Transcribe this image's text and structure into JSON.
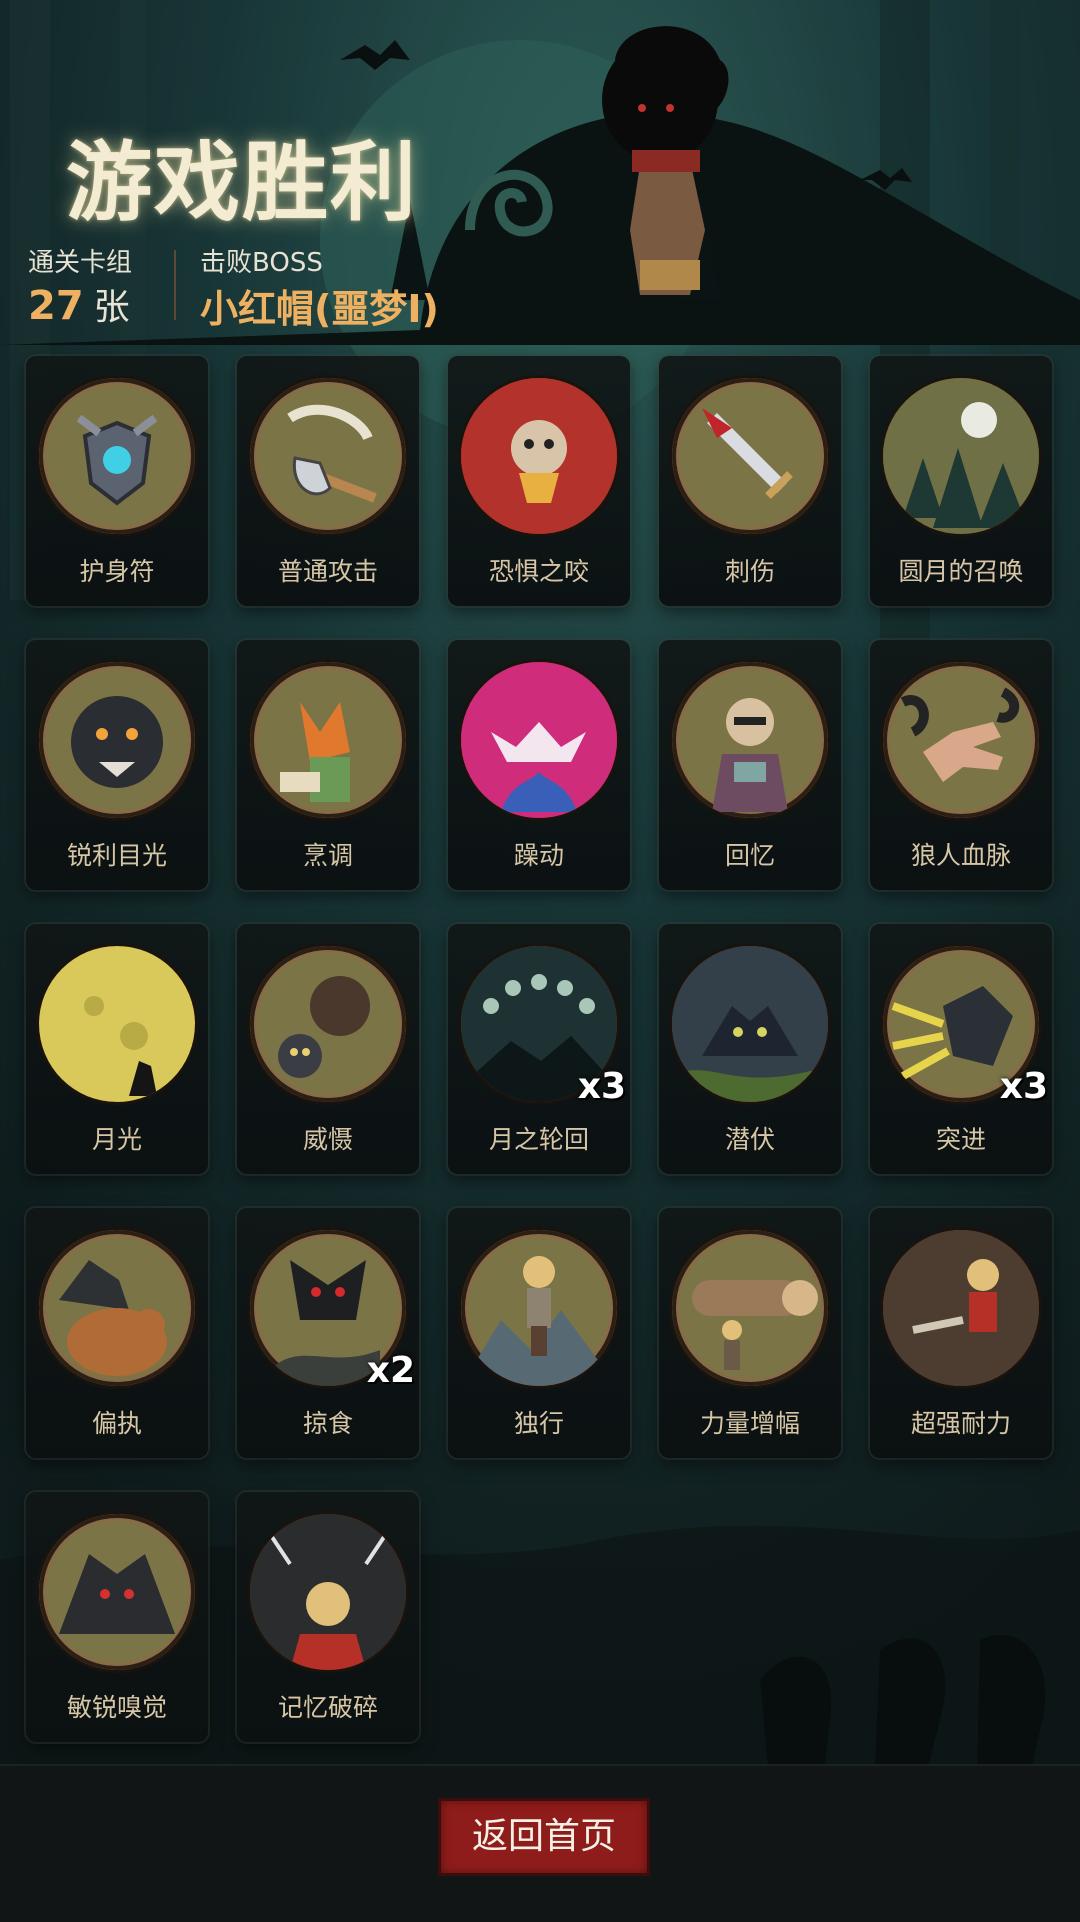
{
  "header": {
    "title": "游戏胜利",
    "deck_label": "通关卡组",
    "deck_count": "27",
    "deck_unit": "张",
    "boss_label": "击败BOSS",
    "boss_name": "小红帽(噩梦I)"
  },
  "cards": [
    {
      "name": "护身符",
      "icon": "amulet-shield-icon"
    },
    {
      "name": "普通攻击",
      "icon": "axe-icon"
    },
    {
      "name": "恐惧之咬",
      "icon": "roaring-beast-icon"
    },
    {
      "name": "刺伤",
      "icon": "dagger-icon"
    },
    {
      "name": "圆月的召唤",
      "icon": "full-moon-forest-icon"
    },
    {
      "name": "锐利目光",
      "icon": "werewolf-glare-icon"
    },
    {
      "name": "烹调",
      "icon": "fox-cook-icon"
    },
    {
      "name": "躁动",
      "icon": "frenzy-icon"
    },
    {
      "name": "回忆",
      "icon": "old-man-icon"
    },
    {
      "name": "狼人血脉",
      "icon": "clawed-hand-icon"
    },
    {
      "name": "月光",
      "icon": "moonlight-icon"
    },
    {
      "name": "威慑",
      "icon": "bear-threat-icon"
    },
    {
      "name": "月之轮回",
      "icon": "moon-phases-icon",
      "count": "x3"
    },
    {
      "name": "潜伏",
      "icon": "lurking-wolf-icon"
    },
    {
      "name": "突进",
      "icon": "charging-wolf-icon",
      "count": "x3"
    },
    {
      "name": "偏执",
      "icon": "wolf-and-bear-icon"
    },
    {
      "name": "掠食",
      "icon": "predator-icon",
      "count": "x2"
    },
    {
      "name": "独行",
      "icon": "lone-hunter-icon"
    },
    {
      "name": "力量增幅",
      "icon": "log-carrier-icon"
    },
    {
      "name": "超强耐力",
      "icon": "woodcutter-icon"
    },
    {
      "name": "敏锐嗅觉",
      "icon": "sniffing-wolf-icon"
    },
    {
      "name": "记忆破碎",
      "icon": "broken-memory-icon"
    }
  ],
  "footer": {
    "home_button": "返回首页"
  },
  "colors": {
    "accent": "#eeb162",
    "card_art_bg": "#7b7446",
    "button": "#8e1c1a"
  }
}
